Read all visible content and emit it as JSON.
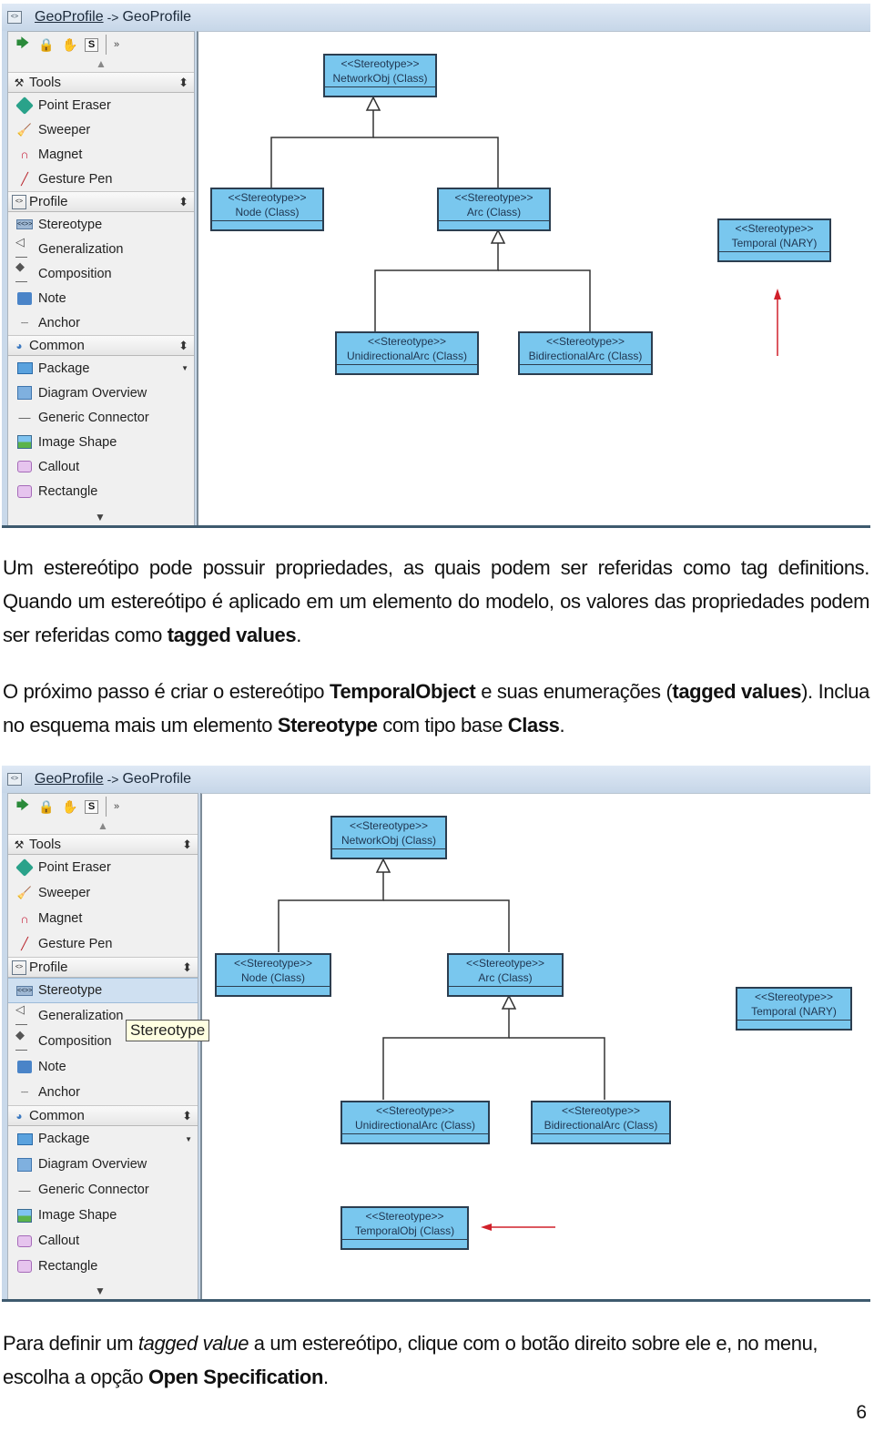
{
  "window": {
    "title_link": "GeoProfile",
    "title_sep": "->",
    "title_tail": "GeoProfile"
  },
  "palette": {
    "toolbar": {
      "select": "select-tool",
      "lock": "lock-tool",
      "hand": "hand-tool",
      "s_label": "S",
      "more": "more"
    },
    "groups": [
      {
        "label": "Tools",
        "items": [
          "Point Eraser",
          "Sweeper",
          "Magnet",
          "Gesture Pen"
        ]
      },
      {
        "label": "Profile",
        "items": [
          "Stereotype",
          "Generalization",
          "Composition",
          "Note",
          "Anchor"
        ]
      },
      {
        "label": "Common",
        "items": [
          "Package",
          "Diagram Overview",
          "Generic Connector",
          "Image Shape",
          "Callout",
          "Rectangle"
        ]
      }
    ],
    "selected_item_window2": "Stereotype",
    "tooltip_window2": "Stereotype"
  },
  "diagram": {
    "stereotype_label": "<<Stereotype>>",
    "classes": {
      "networkobj": "NetworkObj (Class)",
      "node": "Node (Class)",
      "arc": "Arc (Class)",
      "temporal": "Temporal (NARY)",
      "unidirectional": "UnidirectionalArc (Class)",
      "bidirectional": "BidirectionalArc (Class)",
      "temporalobj": "TemporalObj (Class)"
    },
    "annotation_color": "#d0202a",
    "class_fill": "#79c7ee"
  },
  "text": {
    "p1_a": "Um estereótipo pode possuir propriedades, as quais podem ser referidas como tag definitions. Quando um estereótipo é aplicado em um elemento do modelo, os valores das propriedades podem ser referidas como ",
    "p1_b": "tagged values",
    "p1_c": ".",
    "p2_a": "O próximo passo é criar o estereótipo ",
    "p2_b": "TemporalObject",
    "p2_c": " e suas enumerações (",
    "p2_d": "tagged values",
    "p2_e": "). Inclua no esquema mais um elemento ",
    "p2_f": "Stereotype",
    "p2_g": " com tipo base ",
    "p2_h": "Class",
    "p2_i": ".",
    "p3_a": "Para definir um ",
    "p3_b": "tagged value",
    "p3_c": " a um estereótipo, clique com o botão direito sobre ele e, no menu, escolha a opção ",
    "p3_d": "Open Specification",
    "p3_e": ".",
    "page_number": "6"
  }
}
